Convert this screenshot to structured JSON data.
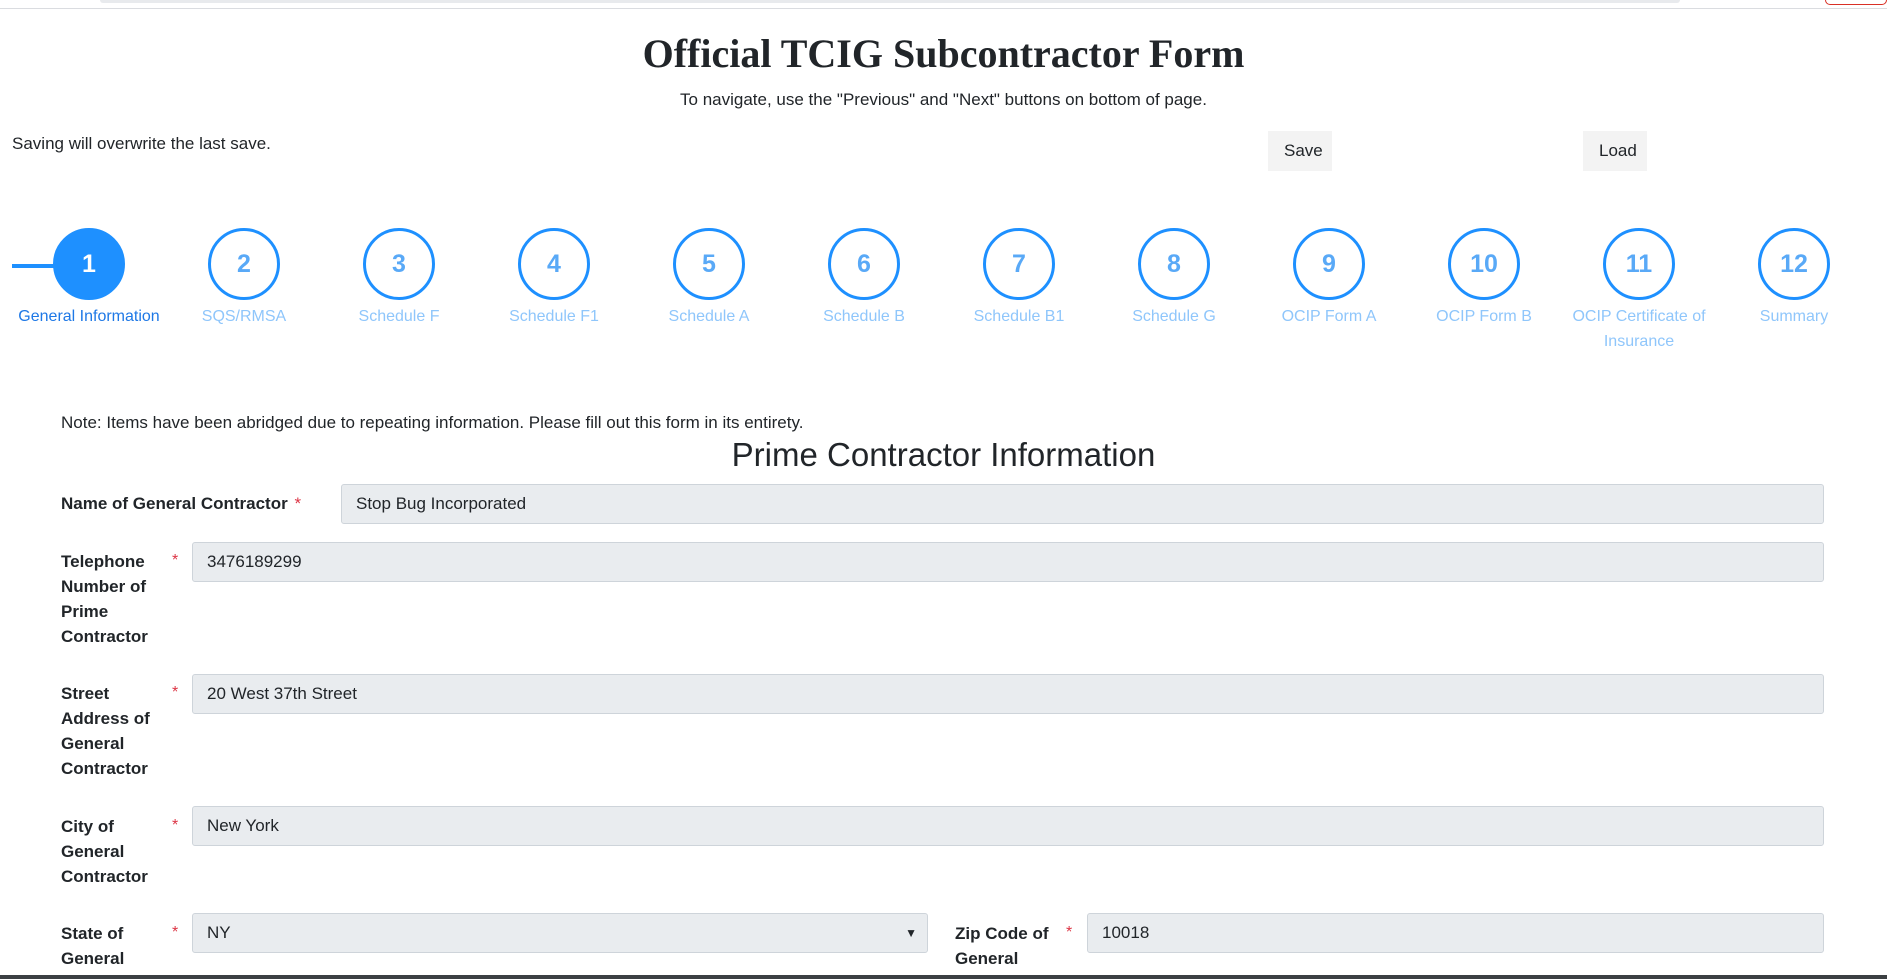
{
  "header": {
    "title": "Official TCIG Subcontractor Form",
    "subtitle": "To navigate, use the \"Previous\" and \"Next\" buttons on bottom of page.",
    "save_note": "Saving will overwrite the last save.",
    "save_label": "Save",
    "load_label": "Load"
  },
  "stepper": {
    "active_index": 0,
    "steps": [
      {
        "number": "1",
        "label": "General Information"
      },
      {
        "number": "2",
        "label": "SQS/RMSA"
      },
      {
        "number": "3",
        "label": "Schedule F"
      },
      {
        "number": "4",
        "label": "Schedule F1"
      },
      {
        "number": "5",
        "label": "Schedule A"
      },
      {
        "number": "6",
        "label": "Schedule B"
      },
      {
        "number": "7",
        "label": "Schedule B1"
      },
      {
        "number": "8",
        "label": "Schedule G"
      },
      {
        "number": "9",
        "label": "OCIP Form A"
      },
      {
        "number": "10",
        "label": "OCIP Form B"
      },
      {
        "number": "11",
        "label": "OCIP Certificate of Insurance"
      },
      {
        "number": "12",
        "label": "Summary"
      }
    ]
  },
  "form": {
    "note": "Note: Items have been abridged due to repeating information. Please fill out this form in its entirety.",
    "section_title": "Prime Contractor Information",
    "required_mark": "*",
    "general_contractor": {
      "label": "Name of General Contractor",
      "value": "Stop Bug Incorporated"
    },
    "telephone": {
      "label": "Telephone Number of Prime Contractor",
      "value": "3476189299"
    },
    "street": {
      "label": "Street Address of General Contractor",
      "value": "20 West 37th Street"
    },
    "city": {
      "label": "City of General Contractor",
      "value": "New York"
    },
    "state": {
      "label": "State of General",
      "value": "NY"
    },
    "zip": {
      "label": "Zip Code of General",
      "value": "10018"
    }
  },
  "colors": {
    "accent": "#1e90ff",
    "step_inactive_text": "#8fc6fb",
    "required": "#dc3545",
    "input_bg": "#e9ecef"
  }
}
